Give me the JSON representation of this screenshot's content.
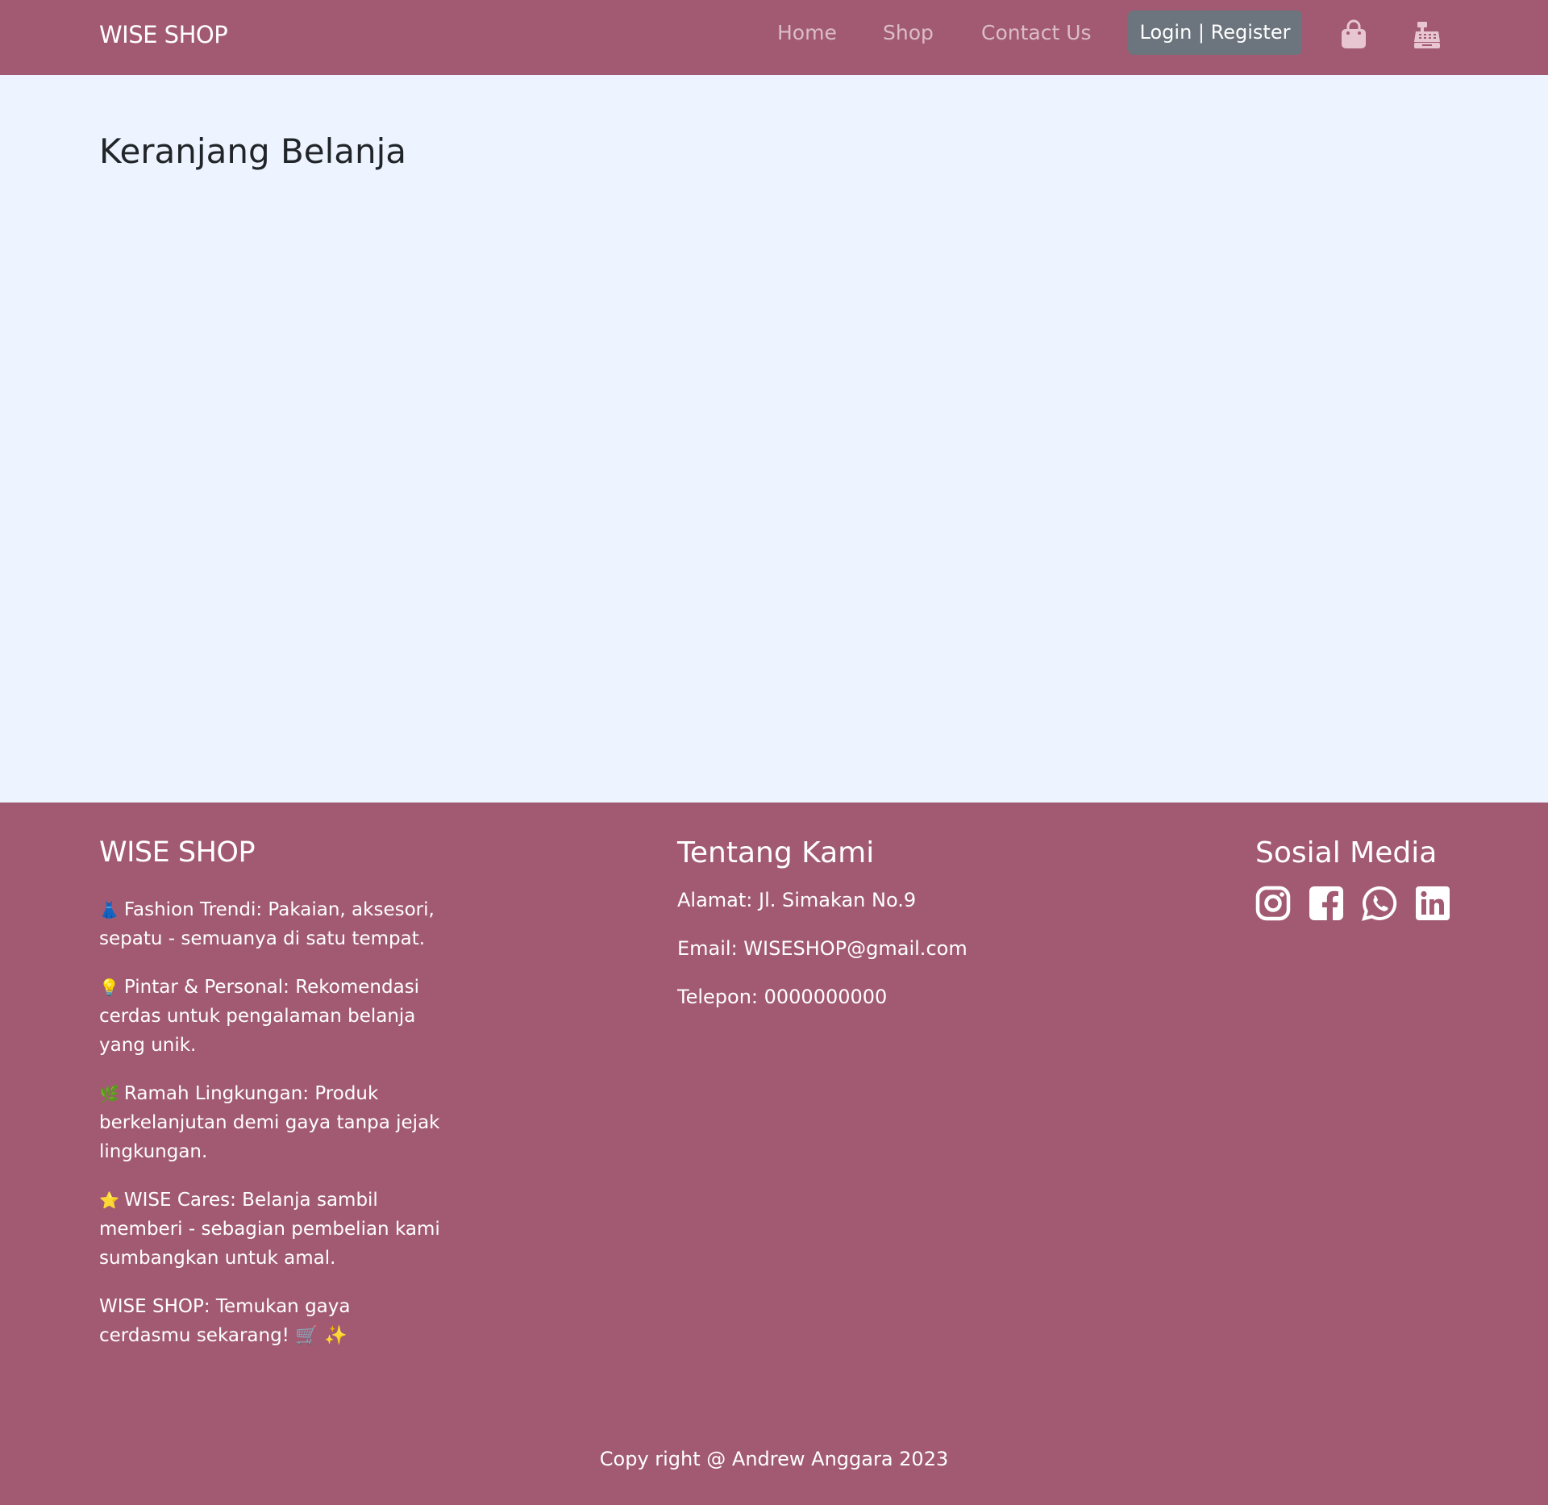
{
  "navbar": {
    "brand": "WISE SHOP",
    "links": [
      "Home",
      "Shop",
      "Contact Us"
    ],
    "login_label": "Login | Register",
    "icons": [
      "shopping-bag-icon",
      "cash-register-icon"
    ]
  },
  "main": {
    "title": "Keranjang Belanja"
  },
  "footer": {
    "brand": {
      "title": "WISE SHOP",
      "features": [
        {
          "emoji": "👗",
          "text": "Fashion Trendi: Pakaian, aksesori, sepatu - semuanya di satu tempat."
        },
        {
          "emoji": "💡",
          "text": "Pintar & Personal: Rekomendasi cerdas untuk pengalaman belanja yang unik."
        },
        {
          "emoji": "🌿",
          "text": "Ramah Lingkungan: Produk berkelanjutan demi gaya tanpa jejak lingkungan."
        },
        {
          "emoji": "⭐",
          "text": "WISE Cares: Belanja sambil memberi - sebagian pembelian kami sumbangkan untuk amal."
        }
      ],
      "tagline": "WISE SHOP: Temukan gaya cerdasmu sekarang! 🛒 ✨"
    },
    "about": {
      "title": "Tentang Kami",
      "address": "Alamat: Jl. Simakan No.9",
      "email": "Email: WISESHOP@gmail.com",
      "phone": "Telepon: 0000000000"
    },
    "social": {
      "title": "Sosial Media",
      "icons": [
        "instagram-icon",
        "facebook-icon",
        "whatsapp-icon",
        "linkedin-icon"
      ]
    },
    "copyright": "Copy right @ Andrew Anggara 2023"
  },
  "colors": {
    "primary": "#a25a72",
    "background": "#eef4ff",
    "button": "#6c757d",
    "nav_link": "rgba(255,255,255,0.6)"
  }
}
